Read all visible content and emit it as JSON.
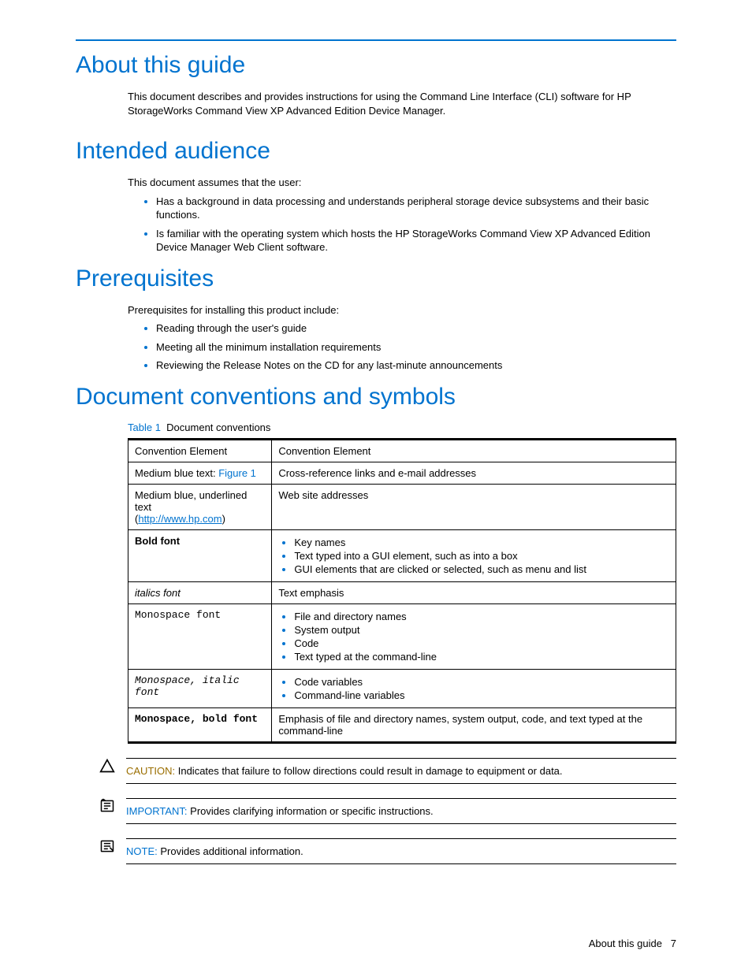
{
  "sections": {
    "about": {
      "title": "About this guide",
      "para": "This document describes and provides instructions for using the Command Line Interface (CLI) software for HP StorageWorks Command View XP Advanced Edition Device Manager."
    },
    "audience": {
      "title": "Intended audience",
      "intro": "This document assumes that the user:",
      "items": [
        "Has a background in data processing and understands peripheral storage device subsystems and their basic functions.",
        "Is familiar with the operating system which hosts the HP StorageWorks Command View XP Advanced Edition Device Manager Web Client software."
      ]
    },
    "prereq": {
      "title": "Prerequisites",
      "intro": "Prerequisites for installing this product include:",
      "items": [
        "Reading through the user's guide",
        "Meeting all the minimum installation requirements",
        "Reviewing the Release Notes on the CD for any last-minute announcements"
      ]
    },
    "conventions": {
      "title": "Document conventions and symbols",
      "table_label": "Table 1",
      "table_caption": "Document conventions",
      "header": {
        "c1": "Convention Element",
        "c2": "Convention Element"
      },
      "rows": {
        "r1": {
          "c1_prefix": "Medium blue text: ",
          "c1_link": "Figure 1",
          "c2": "Cross-reference links and e-mail addresses"
        },
        "r2": {
          "c1_line1": "Medium blue, underlined text",
          "c1_open": "(",
          "c1_url": "http://www.hp.com",
          "c1_close": ")",
          "c2": "Web site addresses"
        },
        "r3": {
          "c1": "Bold font",
          "c2_items": [
            "Key names",
            "Text typed into a GUI element, such as into a box",
            "GUI elements that are clicked or selected, such as menu and list"
          ]
        },
        "r4": {
          "c1": "italics font",
          "c2": "Text emphasis"
        },
        "r5": {
          "c1": "Monospace font",
          "c2_items": [
            "File and directory names",
            "System output",
            "Code",
            "Text typed at the command-line"
          ]
        },
        "r6": {
          "c1": "Monospace, italic font",
          "c2_items": [
            "Code variables",
            "Command-line variables"
          ]
        },
        "r7": {
          "c1": "Monospace, bold font",
          "c2": "Emphasis of file and directory names, system output, code, and text typed at the command-line"
        }
      }
    },
    "notes": {
      "caution": {
        "label": "CAUTION:",
        "text": "  Indicates that failure to follow directions could result in damage to equipment or data."
      },
      "important": {
        "label": "IMPORTANT:",
        "text": "  Provides clarifying information or specific instructions."
      },
      "note": {
        "label": "NOTE:",
        "text": "  Provides additional information."
      }
    }
  },
  "footer": {
    "text": "About this guide",
    "page": "7"
  }
}
